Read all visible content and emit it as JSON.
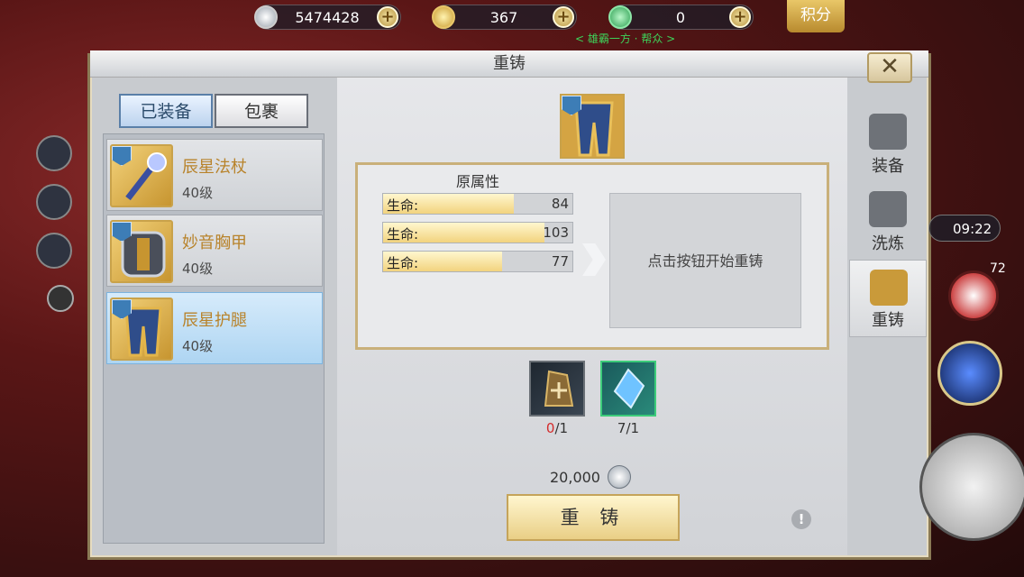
{
  "currency": {
    "silver": "5474428",
    "gold": "367",
    "third": "0",
    "plus": "+",
    "points_label": "积分"
  },
  "banner": "< 雄霸一方 · 帮众 >",
  "window": {
    "title": "重铸",
    "close": "✕"
  },
  "tabs": {
    "equipped": "已装备",
    "bag": "包裹"
  },
  "items": [
    {
      "name": "辰星法杖",
      "level": "40级"
    },
    {
      "name": "妙音胸甲",
      "level": "40级"
    },
    {
      "name": "辰星护腿",
      "level": "40级"
    }
  ],
  "attrs": {
    "header": "原属性",
    "rows": [
      {
        "label": "生命:",
        "value": "84",
        "fill": 0.69
      },
      {
        "label": "生命:",
        "value": "103",
        "fill": 0.85
      },
      {
        "label": "生命:",
        "value": "77",
        "fill": 0.63
      }
    ]
  },
  "result_hint": "点击按钮开始重铸",
  "materials": [
    {
      "count_have": "0",
      "count_need": "/1",
      "have_color": "#d42b2b"
    },
    {
      "count_have": "7",
      "count_need": "/1",
      "have_color": "#333333"
    }
  ],
  "cost": "20,000",
  "recast_button": "重 铸",
  "info": "!",
  "right_tabs": [
    {
      "label": "装备"
    },
    {
      "label": "洗炼"
    },
    {
      "label": "重铸"
    }
  ],
  "hud": {
    "time": "09:22",
    "orb_count": "72"
  }
}
